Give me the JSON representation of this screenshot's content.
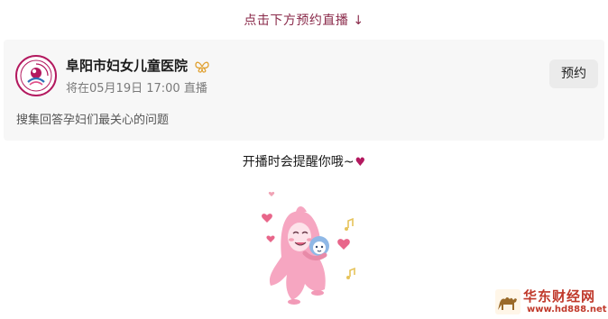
{
  "header": {
    "hint_text": "点击下方预约直播 ↓"
  },
  "live_card": {
    "org_name": "阜阳市妇女儿童医院",
    "verified_icon": "butterfly-verified-icon",
    "schedule": "将在05月19日 17:00 直播",
    "reserve_label": "预约",
    "description": "搜集回答孕妇们最关心的问题",
    "avatar_icon": "hospital-logo-icon"
  },
  "remind": {
    "text": "开播时会提醒你哦~",
    "heart": "♥"
  },
  "illustration": {
    "icon": "mascot-illustration"
  },
  "watermark": {
    "title": "华东财经网",
    "url": "www.hd888.net",
    "logo_icon": "camel-logo-icon"
  },
  "colors": {
    "accent": "#b3195f",
    "hint": "#8a2a4a",
    "card_bg": "#f7f7f7",
    "button_bg": "#ebebeb"
  }
}
